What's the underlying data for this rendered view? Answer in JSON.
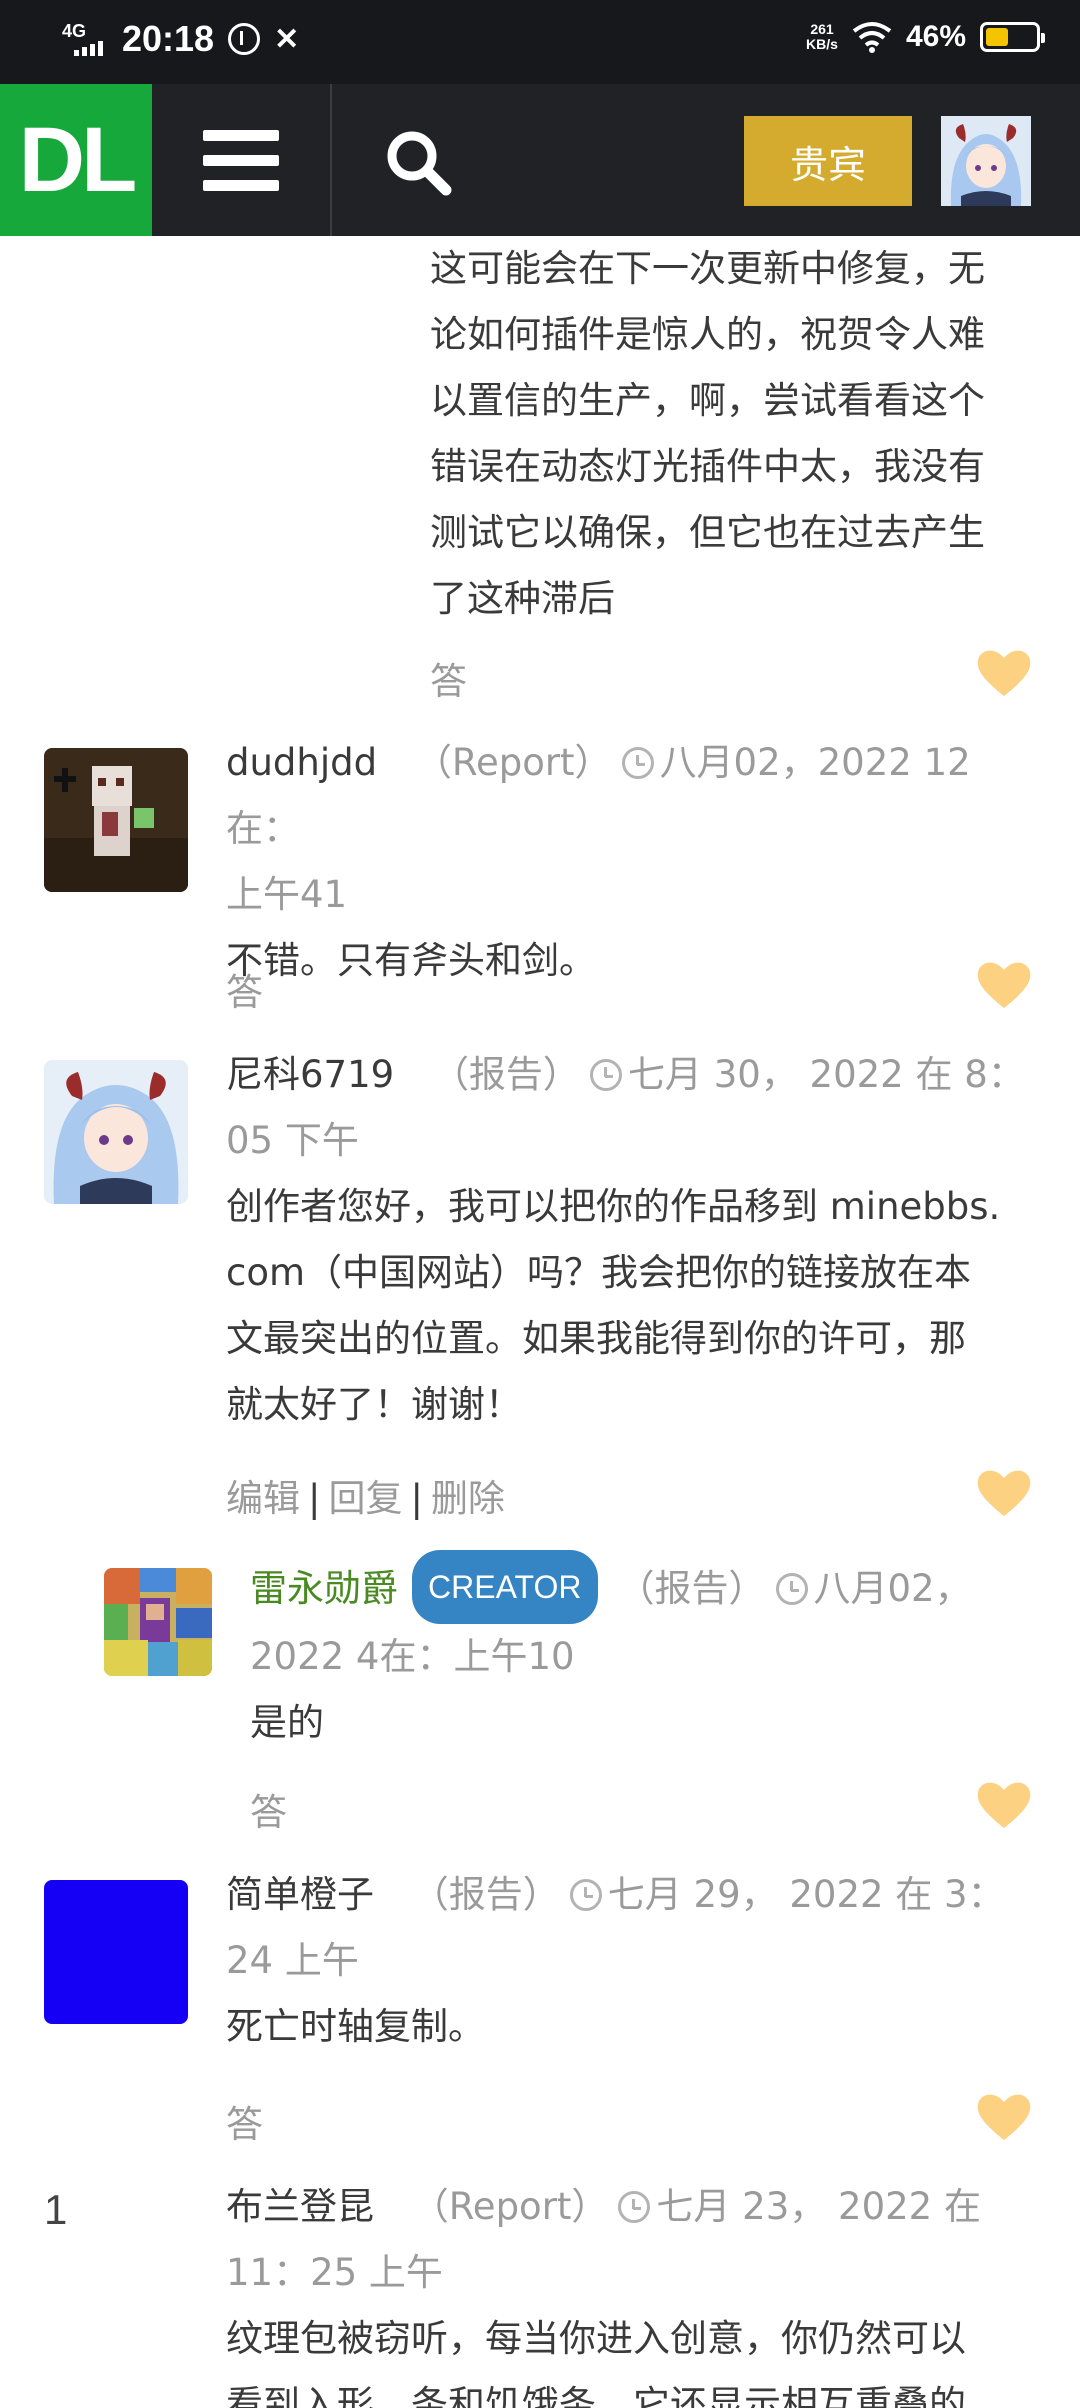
{
  "status_bar": {
    "network": "4G",
    "time": "20:18",
    "speed_value": "261",
    "speed_unit": "KB/s",
    "battery_pct": "46%",
    "battery_level": 0.46
  },
  "header": {
    "logo_text": "DL",
    "guest_label": "贵宾",
    "brand_green": "#16a83a",
    "guest_color": "#d4ab2f"
  },
  "comments": [
    {
      "text_lines": [
        "这可能会在下一次更新中修复，无",
        "论如何插件是惊人的，祝贺令人难",
        "以置信的生产，啊，尝试看看这个",
        "错误在动态灯光插件中太，我没有",
        "测试它以确保，但它也在过去产生",
        "了这种滞后"
      ],
      "reply": "答"
    },
    {
      "author": "dudhjdd",
      "report": "（Report）",
      "date_line1": "八月02，2022 12在：",
      "date_line2": "上午41",
      "text": "不错。只有斧头和剑。",
      "reply": "答"
    },
    {
      "author": "尼科6719",
      "report": "（报告）",
      "date_line1": "七月 30， 2022 在 8：",
      "date_line2": "05 下午",
      "text_lines": [
        "创作者您好，我可以把你的作品移到 minebbs.",
        "com（中国网站）吗？我会把你的链接放在本",
        "文最突出的位置。如果我能得到你的许可，那",
        "就太好了！谢谢！"
      ],
      "actions": [
        "编辑",
        "回复",
        "删除"
      ]
    },
    {
      "author": "雷永勋爵",
      "badge": "CREATOR",
      "report": "（报告）",
      "date_line1": "八月02，",
      "date_line2": "2022 4在：上午10",
      "text": "是的",
      "reply": "答"
    },
    {
      "author": "简单橙子",
      "report": "（报告）",
      "date_line1": "七月 29， 2022 在 3：",
      "date_line2": "24 上午",
      "text": "死亡时轴复制。",
      "reply": "答"
    },
    {
      "author": "布兰登昆",
      "avatar_text": "1",
      "report": "（Report）",
      "date_line1": "七月 23， 2022 在",
      "date_line2": "11：25 上午",
      "text_lines": [
        "纹理包被窃听，每当你进入创意，你仍然可以",
        "看到入形，条和饥饿条，它还显示相互重叠的"
      ]
    }
  ]
}
